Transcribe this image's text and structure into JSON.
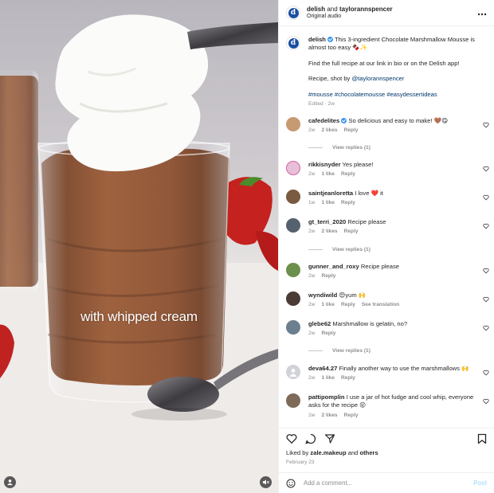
{
  "media": {
    "overlay_caption": "with whipped cream",
    "user_tag_icon": "user-tag-icon",
    "mute_icon": "speaker-muted-icon"
  },
  "header": {
    "author": "delish",
    "coauthor_join": "and",
    "coauthor": "taylorannspencer",
    "audio": "Original audio",
    "more_icon": "more-horizontal-icon"
  },
  "post": {
    "author": "delish",
    "caption_line1": "This 3-ingredient Chocolate Marshmallow Mousse is almost too easy 🍫✨",
    "caption_line2": "Find the full recipe at our link in bio or on the Delish app!",
    "caption_line3_prefix": "Recipe, shot by",
    "caption_mention": "@taylorannspencer",
    "hashtags": "#mousse #chocolatemousse #easydessertideas",
    "edited": "Edited · 2w"
  },
  "comments": [
    {
      "user": "cafedelites",
      "text": "So delicious and easy to make! 🤎😋",
      "time": "2w",
      "likes": "2 likes",
      "reply": "Reply",
      "replies": "View replies (1)",
      "avatar_color": "#c79a72"
    },
    {
      "user": "rikkisnyder",
      "text": "Yes please!",
      "time": "2w",
      "likes": "1 like",
      "reply": "Reply",
      "avatar_color": "#e7c0d8"
    },
    {
      "user": "saintjeanloretta",
      "text": "I love ❤️ it",
      "time": "1w",
      "likes": "1 like",
      "reply": "Reply",
      "avatar_color": "#7a5a40"
    },
    {
      "user": "gt_terri_2020",
      "text": "Recipe please",
      "time": "2w",
      "likes": "2 likes",
      "reply": "Reply",
      "replies": "View replies (1)",
      "avatar_color": "#55616d"
    },
    {
      "user": "gunner_and_roxy",
      "text": "Recipe please",
      "time": "2w",
      "reply": "Reply",
      "avatar_color": "#6c8f4d"
    },
    {
      "user": "wyndiwild",
      "text": "😍yum 🙌",
      "time": "2w",
      "likes": "1 like",
      "reply": "Reply",
      "translate": "See translation",
      "avatar_color": "#4a3c34"
    },
    {
      "user": "glebe62",
      "text": "Marshmallow is gelatin, no?",
      "time": "2w",
      "reply": "Reply",
      "replies": "View replies (1)",
      "avatar_color": "#6c7f8f"
    },
    {
      "user": "deva64.27",
      "text": "Finally another way to use the marshmallows 🙌",
      "time": "2w",
      "likes": "1 like",
      "reply": "Reply",
      "avatar_color": "#cfd3d8"
    },
    {
      "user": "pattipomplin",
      "text": "I use a jar of hot fudge and cool whip, everyone asks for the recipe 😜",
      "time": "2w",
      "likes": "2 likes",
      "reply": "Reply",
      "avatar_color": "#7d6a58"
    }
  ],
  "actions": {
    "like_icon": "heart-icon",
    "comment_icon": "comment-icon",
    "share_icon": "send-icon",
    "save_icon": "bookmark-icon",
    "liked_prefix": "Liked by",
    "liked_user": "zale.makeup",
    "liked_join": "and",
    "liked_others": "others",
    "date": "February 23"
  },
  "composer": {
    "emoji_icon": "emoji-icon",
    "placeholder": "Add a comment...",
    "post_label": "Post"
  },
  "colors": {
    "link": "#00376b",
    "muted": "#8e8e8e",
    "post_disabled": "#b2dffc",
    "brand_delish": "#1b4fa3"
  }
}
